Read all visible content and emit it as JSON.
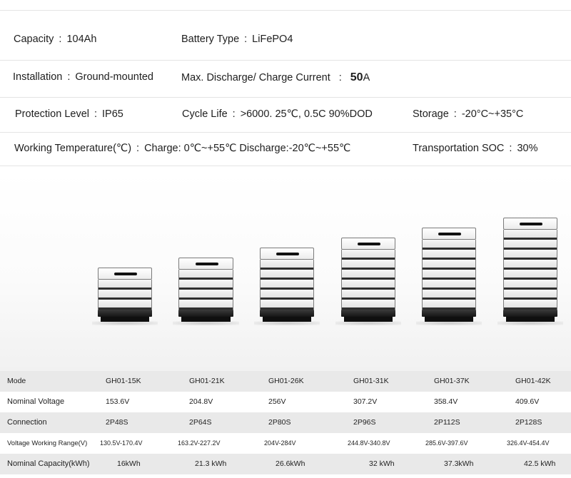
{
  "specs": {
    "capacity": {
      "label": "Capacity",
      "value": "104Ah"
    },
    "battery_type": {
      "label": "Battery Type",
      "value": "LiFePO4"
    },
    "installation": {
      "label": "Installation",
      "value": "Ground-mounted"
    },
    "max_current": {
      "label": "Max. Discharge/ Charge Current",
      "value": "50",
      "unit": "A"
    },
    "protection": {
      "label": "Protection  Level",
      "value": "IP65"
    },
    "cycle_life": {
      "label": "Cycle Life",
      "value": ">6000.  25℃,  0.5C  90%DOD"
    },
    "storage": {
      "label": "Storage",
      "value": "-20°C~+35°C"
    },
    "working_temp": {
      "label": "Working Temperature(℃)",
      "value": "Charge: 0℃~+55℃  Discharge:-20℃~+55℃"
    },
    "transport_soc": {
      "label": "Transportation SOC",
      "value": "30%"
    }
  },
  "table": {
    "rows": [
      {
        "label": "Mode",
        "cells": [
          "GH01-15K",
          "GH01-21K",
          "GH01-26K",
          "GH01-31K",
          "GH01-37K",
          "GH01-42K"
        ]
      },
      {
        "label": "Nominal Voltage",
        "cells": [
          "153.6V",
          "204.8V",
          "256V",
          "307.2V",
          "358.4V",
          "409.6V"
        ]
      },
      {
        "label": "Connection",
        "cells": [
          "2P48S",
          "2P64S",
          "2P80S",
          "2P96S",
          "2P112S",
          "2P128S"
        ]
      },
      {
        "label": "Voltage Working Range(V)",
        "cells": [
          "130.5V-170.4V",
          "163.2V-227.2V",
          "204V-284V",
          "244.8V-340.8V",
          "285.6V-397.6V",
          "326.4V-454.4V"
        ]
      },
      {
        "label": "Nominal Capacity(kWh)",
        "cells": [
          "16kWh",
          "21.3 kWh",
          "26.6kWh",
          "32 kWh",
          "37.3kWh",
          "42.5 kWh"
        ]
      }
    ]
  },
  "battery_stacks": [
    {
      "model": "GH01-15K",
      "modules": 3
    },
    {
      "model": "GH01-21K",
      "modules": 4
    },
    {
      "model": "GH01-26K",
      "modules": 5
    },
    {
      "model": "GH01-31K",
      "modules": 6
    },
    {
      "model": "GH01-37K",
      "modules": 7
    },
    {
      "model": "GH01-42K",
      "modules": 8
    }
  ]
}
